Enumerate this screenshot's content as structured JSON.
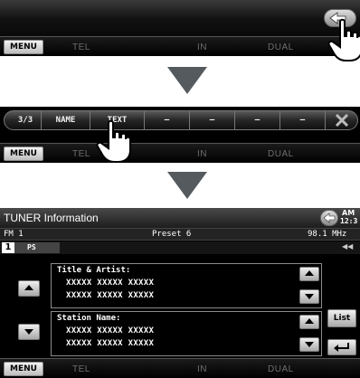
{
  "panel1": {
    "menu_label": "MENU",
    "sources": [
      "TEL",
      "IN",
      "DUAL"
    ],
    "back_icon": "back-arrow-icon"
  },
  "panel2": {
    "page_indicator": "3/3",
    "name_label": "NAME",
    "text_label": "TEXT",
    "blank_items": [
      "—",
      "—",
      "—",
      "—"
    ],
    "close_icon": "x-icon",
    "menu_label": "MENU",
    "sources": [
      "TEL",
      "IN",
      "DUAL"
    ]
  },
  "panel3": {
    "title": "TUNER Information",
    "am_label": "AM",
    "clock": "12:3",
    "band": "FM 1",
    "preset": "Preset 6",
    "frequency": "98.1 MHz",
    "preset_number": "1",
    "ps_label": "PS",
    "title_artist": {
      "label": "Title & Artist:",
      "lines": [
        "XXXXX XXXXX XXXXX",
        "XXXXX XXXXX XXXXX"
      ]
    },
    "station_name": {
      "label": "Station Name:",
      "lines": [
        "XXXXX XXXXX XXXXX",
        "XXXXX XXXXX XXXXX"
      ]
    },
    "list_label": "List",
    "menu_label": "MENU",
    "sources": [
      "TEL",
      "IN",
      "DUAL"
    ]
  },
  "colors": {
    "arrow": "#555a5e",
    "screen_bg": "#000000"
  }
}
